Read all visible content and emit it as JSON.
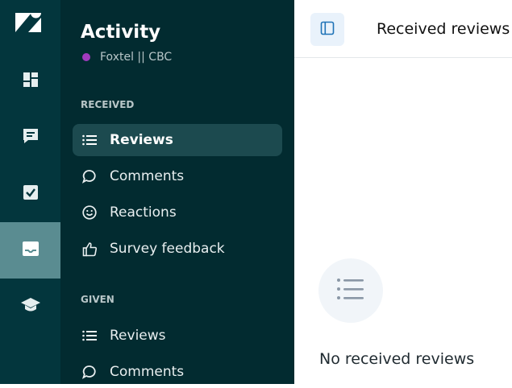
{
  "rail": {
    "items": [
      {
        "icon": "dashboard-icon",
        "active": false
      },
      {
        "icon": "chat-icon",
        "active": false
      },
      {
        "icon": "checkbox-icon",
        "active": false
      },
      {
        "icon": "inbox-icon",
        "active": true
      },
      {
        "icon": "graduation-cap-icon",
        "active": false
      }
    ]
  },
  "sidebar": {
    "title": "Activity",
    "org": "Foxtel || CBC",
    "org_color": "#a23bbf",
    "received_heading": "RECEIVED",
    "received_items": [
      {
        "label": "Reviews",
        "icon": "list-icon",
        "active": true
      },
      {
        "label": "Comments",
        "icon": "comment-icon",
        "active": false
      },
      {
        "label": "Reactions",
        "icon": "smiley-icon",
        "active": false
      },
      {
        "label": "Survey feedback",
        "icon": "thumbs-up-icon",
        "active": false
      }
    ],
    "given_heading": "GIVEN",
    "given_items": [
      {
        "label": "Reviews",
        "icon": "list-icon",
        "active": false
      },
      {
        "label": "Comments",
        "icon": "comment-icon",
        "active": false
      }
    ]
  },
  "main": {
    "title": "Received reviews",
    "empty_text": "No received reviews"
  },
  "colors": {
    "rail_bg": "#03363d",
    "sidebar_bg": "#022b30",
    "active_item_bg": "#1c4a4f",
    "rail_active_bg": "#5a8c91"
  }
}
